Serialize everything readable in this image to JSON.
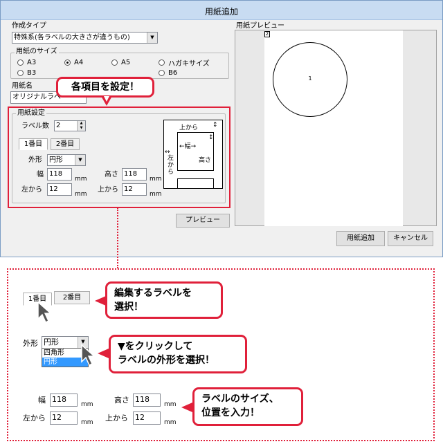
{
  "dialog": {
    "title": "用紙追加",
    "creation_type": {
      "label": "作成タイプ",
      "value": "特殊系(各ラベルの大きさが違うもの)"
    },
    "paper_size": {
      "label": "用紙のサイズ",
      "options": [
        "A3",
        "A4",
        "A5",
        "ハガキサイズ",
        "B3",
        "B6"
      ],
      "selected": "A4"
    },
    "paper_name": {
      "label": "用紙名",
      "value": "オリジナルラベ"
    },
    "label_settings": {
      "label": "用紙設定",
      "count_label": "ラベル数",
      "count_value": "2",
      "tabs": [
        "1番目",
        "2番目"
      ],
      "shape_label": "外形",
      "shape_value": "円形",
      "width_label": "幅",
      "width_value": "118",
      "height_label": "高さ",
      "height_value": "118",
      "left_label": "左から",
      "left_value": "12",
      "top_label": "上から",
      "top_value": "12",
      "unit": "mm",
      "diagram": {
        "top": "上から",
        "width": "幅",
        "height": "高さ",
        "left": "左から"
      }
    },
    "preview_button": "プレビュー",
    "preview_panel": {
      "label": "用紙プレビュー",
      "page_number": "2",
      "circle_number": "1"
    },
    "add_button": "用紙追加",
    "cancel_button": "キャンセル"
  },
  "callouts": {
    "set_items": "各項目を設定！",
    "select_label": [
      "編集するラベルを",
      "選択！"
    ],
    "select_shape": [
      "▼をクリックして",
      "ラベルの外形を選択！"
    ],
    "enter_size": [
      "ラベルのサイズ、",
      "位置を入力！"
    ]
  },
  "zoom": {
    "tabs": [
      "1番目",
      "2番目"
    ],
    "shape_label": "外形",
    "shape_value": "円形",
    "shape_options": [
      "四角形",
      "円形"
    ],
    "shape_option_selected": "円形",
    "width_label": "幅",
    "width_value": "118",
    "height_label": "高さ",
    "height_value": "118",
    "left_label": "左から",
    "left_value": "12",
    "top_label": "上から",
    "top_value": "12",
    "unit": "mm"
  },
  "colors": {
    "accent_red": "#e0203a",
    "title_bar": "#c8dcf2",
    "selection": "#3399ff"
  }
}
